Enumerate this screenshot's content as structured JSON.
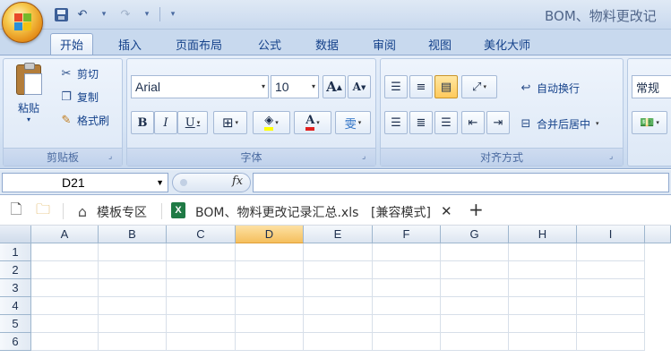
{
  "title_bar": {
    "document_title": "BOM、物料更改记"
  },
  "tabs": [
    "开始",
    "插入",
    "页面布局",
    "公式",
    "数据",
    "审阅",
    "视图",
    "美化大师"
  ],
  "ribbon": {
    "clipboard": {
      "label": "剪贴板",
      "paste_label": "粘贴",
      "cut_label": "剪切",
      "copy_label": "复制",
      "format_painter_label": "格式刷"
    },
    "font": {
      "label": "字体",
      "font_name": "Arial",
      "font_size": "10",
      "bold": "B",
      "italic": "I",
      "underline": "U",
      "grow": "A",
      "shrink": "A",
      "font_color_letter": "A",
      "phonetic": "雯"
    },
    "alignment": {
      "label": "对齐方式",
      "wrap_text_label": "自动换行",
      "merge_center_label": "合并后居中"
    },
    "number": {
      "format_value": "常规"
    }
  },
  "formula_bar": {
    "name_box_value": "D21",
    "fx_label": "fx"
  },
  "document_tabs": {
    "template_zone_label": "模板专区",
    "file_tab_label": "BOM、物料更改记录汇总.xls",
    "compat_mode_label": "[兼容模式]",
    "close_glyph": "✕",
    "add_glyph": "+"
  },
  "sheet": {
    "columns": [
      "A",
      "B",
      "C",
      "D",
      "E",
      "F",
      "G",
      "H",
      "I"
    ],
    "selected_column": "D",
    "rows": [
      "1",
      "2",
      "3",
      "4",
      "5",
      "6"
    ]
  },
  "icons": {
    "office_button": "office-logo-icon",
    "save": "save-icon",
    "undo": "undo-icon",
    "redo": "redo-icon",
    "cut": "scissors-icon",
    "copy": "copy-icon",
    "format_painter": "brush-icon",
    "borders": "border-icon",
    "fill_color": "paint-bucket-icon",
    "align": "align-icon",
    "orientation": "text-orientation-icon",
    "indent": "indent-icon",
    "new_doc": "new-file-icon",
    "folder": "folder-icon",
    "home": "home-icon",
    "excel_file": "excel-icon"
  },
  "colors": {
    "accent_selected_header": "#f5bf5d",
    "ribbon_blue": "#dbe6f6",
    "font_color_bar": "#e02020",
    "fill_color_bar": "#ffff00",
    "excel_green": "#1f7a45"
  }
}
